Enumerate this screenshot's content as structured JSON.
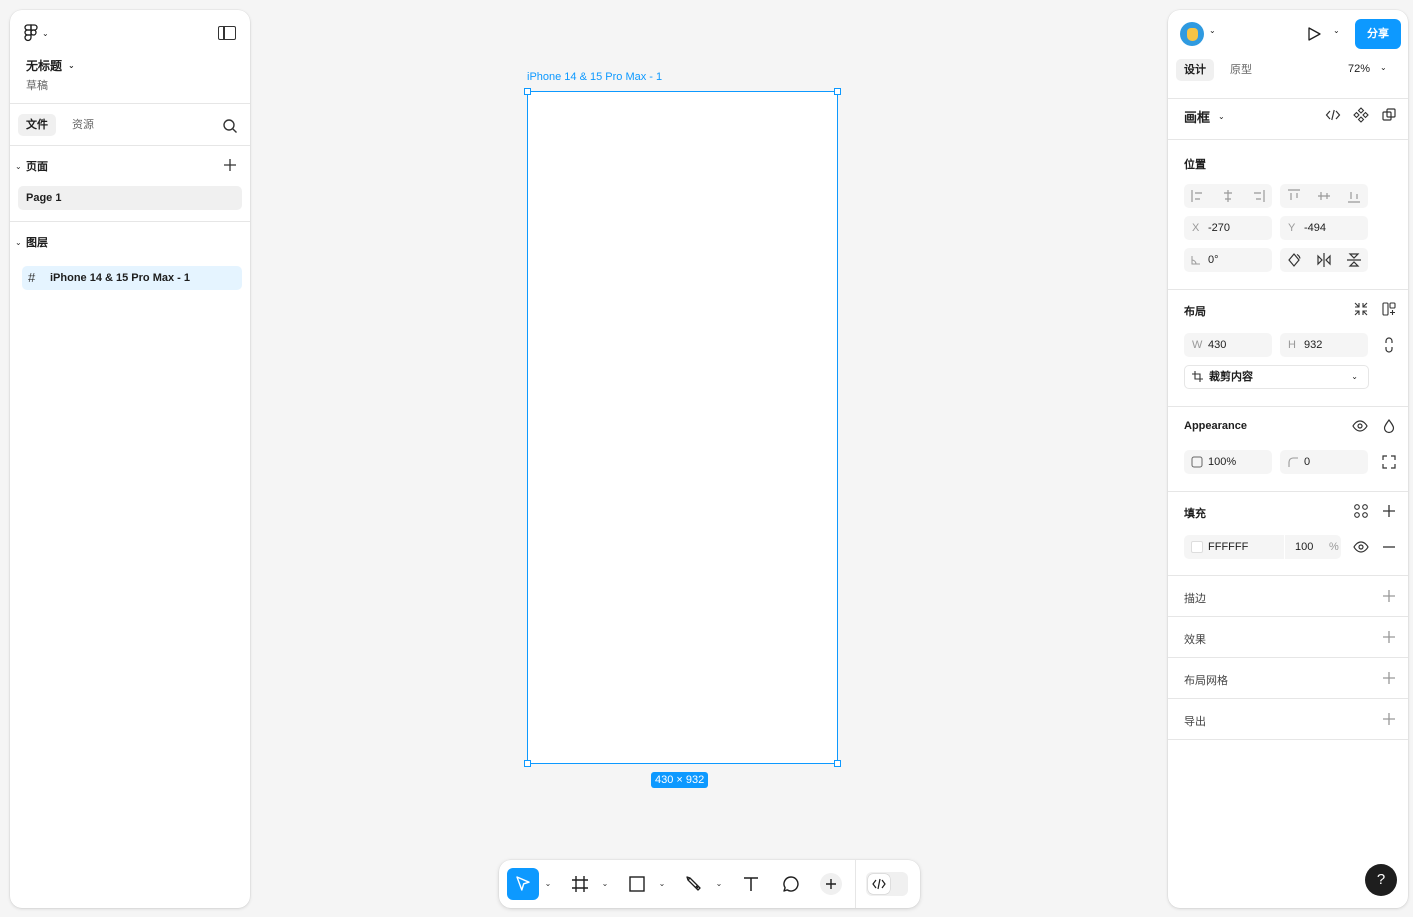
{
  "left_panel": {
    "file_title": "无标题",
    "file_subtitle": "草稿",
    "tabs": [
      {
        "label": "文件"
      },
      {
        "label": "资源"
      }
    ],
    "pages_section": "页面",
    "pages": [
      {
        "label": "Page 1"
      }
    ],
    "layers_section": "图层",
    "layers": [
      {
        "label": "iPhone 14 & 15 Pro Max - 1"
      }
    ]
  },
  "canvas": {
    "frame_label": "iPhone 14 & 15 Pro Max - 1",
    "size_badge": "430 × 932",
    "frame_fill": "#FFFFFF",
    "selection_color": "#0d99ff"
  },
  "toolbar": {
    "tools": [
      "move-tool",
      "frame-tool",
      "shape-tool",
      "pen-tool",
      "text-tool",
      "comment-tool",
      "actions-tool"
    ],
    "active_tool": "move-tool",
    "dev_mode": "dev-mode-toggle"
  },
  "right_panel": {
    "share_label": "分享",
    "tabs": [
      {
        "label": "设计"
      },
      {
        "label": "原型"
      }
    ],
    "zoom": "72%",
    "frame_section": "画框",
    "position": {
      "title": "位置",
      "x_prefix": "X",
      "x": "-270",
      "y_prefix": "Y",
      "y": "-494",
      "rotation": "0°"
    },
    "layout": {
      "title": "布局",
      "w_prefix": "W",
      "w": "430",
      "h_prefix": "H",
      "h": "932",
      "clip_label": "裁剪内容"
    },
    "appearance": {
      "title": "Appearance",
      "opacity": "100%",
      "radius": "0"
    },
    "fill": {
      "title": "填充",
      "hex": "FFFFFF",
      "opacity": "100",
      "percent": "%"
    },
    "stroke": "描边",
    "effects": "效果",
    "layout_grid": "布局网格",
    "export": "导出",
    "help": "?"
  }
}
